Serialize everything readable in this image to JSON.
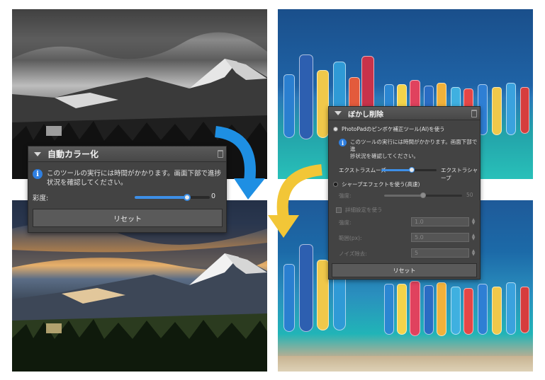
{
  "auto_color_panel": {
    "title": "自動カラー化",
    "info_text_line1": "このツールの実行には時間がかかります。画面下部で進捗",
    "info_text_line2": "状況を確認してください。",
    "saturation_label": "彩度:",
    "saturation_value": "0",
    "saturation_level": 0.7,
    "reset_label": "リセット"
  },
  "unblur_panel": {
    "title": "ぼかし削除",
    "ai_option_label": "PhotoPadのピンボケ補正ツール(AI)を使う",
    "info_text_line1": "このツールの実行には時間がかかります。画面下部で進",
    "info_text_line2": "捗状況を確認してください。",
    "extra_smooth_label": "エクストラスムーズ",
    "extra_sharp_label": "エクストラシャープ",
    "smooth_sharp_level": 0.55,
    "sharpen_option_label": "シャープエフェクトを使う(高速)",
    "strength_label": "強度:",
    "strength_value": "50",
    "strength_level": 0.5,
    "detail_settings_label": "詳細設定を使う",
    "fields": [
      {
        "label": "強度:",
        "value": "1.0"
      },
      {
        "label": "範囲(px):",
        "value": "5.0"
      },
      {
        "label": "ノイズ除去:",
        "value": "5"
      }
    ],
    "reset_label": "リセット"
  },
  "colors": {
    "arrow_blue": "#1e8fe3",
    "arrow_yellow": "#f2c637",
    "slider_accent": "#3d8fe6"
  },
  "icons": [
    "info-icon",
    "trash-icon",
    "collapse-triangle-icon"
  ]
}
